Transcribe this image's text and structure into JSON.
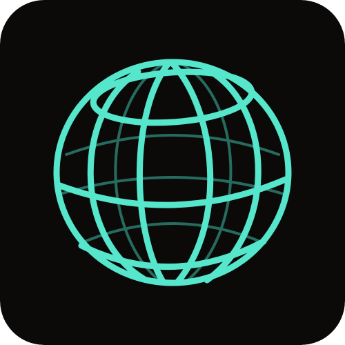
{
  "icon": {
    "name": "globe-icon",
    "background_color": "#0b0a08",
    "accent_color": "#55e6cc",
    "back_line_color": "#2d7c6f"
  }
}
